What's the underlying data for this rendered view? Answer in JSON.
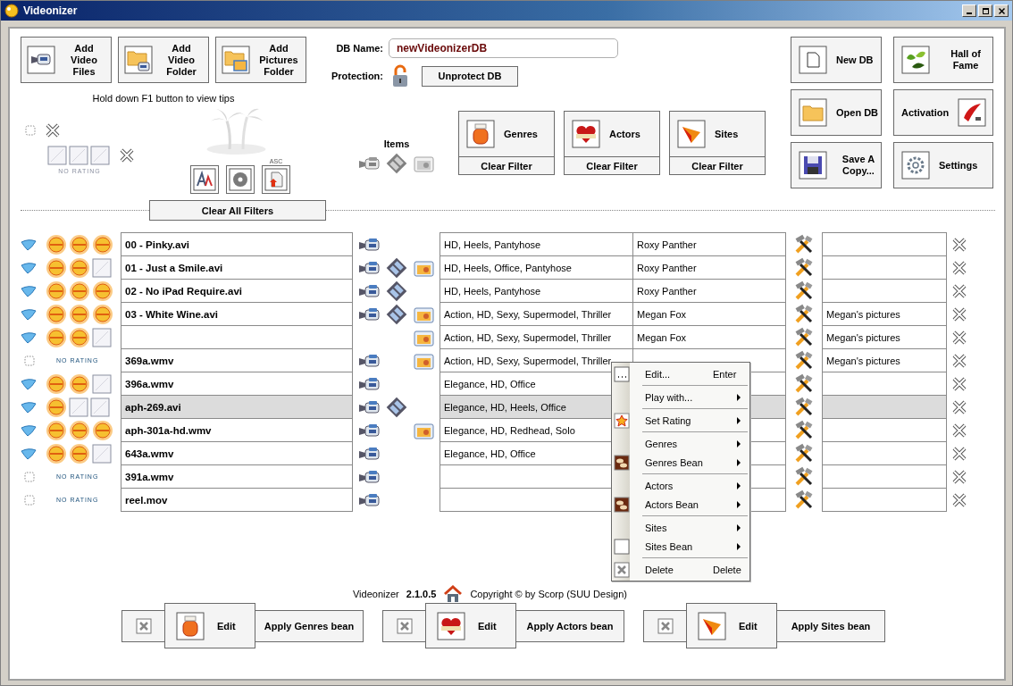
{
  "window": {
    "title": "Videonizer"
  },
  "add_buttons": [
    {
      "label": "Add Video Files"
    },
    {
      "label": "Add Video Folder"
    },
    {
      "label": "Add Pictures Folder"
    }
  ],
  "tip": "Hold down F1 button to view tips",
  "db": {
    "name_label": "DB Name:",
    "name_value": "newVideonizerDB",
    "protection_label": "Protection:",
    "protect_button": "Unprotect DB"
  },
  "db_buttons": [
    {
      "label": "New DB"
    },
    {
      "label": "Hall of Fame"
    },
    {
      "label": "Open DB"
    },
    {
      "label": "Activation"
    },
    {
      "label": "Save A Copy..."
    },
    {
      "label": "Settings"
    }
  ],
  "filter": {
    "checked": false,
    "stars": 0,
    "rating_label": "NO RATING",
    "sort_order_label": "ASC"
  },
  "items_filter": {
    "label": "Items"
  },
  "category_filters": [
    {
      "label": "Genres",
      "clear": "Clear Filter"
    },
    {
      "label": "Actors",
      "clear": "Clear Filter"
    },
    {
      "label": "Sites",
      "clear": "Clear Filter"
    }
  ],
  "clear_all": "Clear All Filters",
  "rows": [
    {
      "checked": true,
      "stars": 3,
      "name": "00 - Pinky.avi",
      "video": true,
      "film": false,
      "picture": false,
      "genres": "HD, Heels, Pantyhose",
      "actors": "Roxy Panther",
      "selected": false
    },
    {
      "checked": true,
      "stars": 2,
      "name": "01 - Just a Smile.avi",
      "video": true,
      "film": true,
      "picture": true,
      "genres": "HD, Heels, Office, Pantyhose",
      "actors": "Roxy Panther",
      "selected": false
    },
    {
      "checked": true,
      "stars": 3,
      "name": "02 - No iPad Require.avi",
      "video": true,
      "film": true,
      "picture": false,
      "genres": "HD, Heels, Pantyhose",
      "actors": "Roxy Panther",
      "selected": false
    },
    {
      "checked": true,
      "stars": 3,
      "name": "03 - White Wine.avi",
      "video": true,
      "film": true,
      "picture": true,
      "genres": "Action, HD, Sexy, Supermodel, Thriller",
      "actors": "Megan Fox",
      "sites": "Megan's pictures",
      "selected": false
    },
    {
      "checked": true,
      "stars": 2,
      "video": false,
      "film": false,
      "picture": true,
      "genres": "Action, HD, Sexy, Supermodel, Thriller",
      "actors": "Megan Fox",
      "sites": "Megan's pictures",
      "selected": false
    },
    {
      "checked": false,
      "rating_label": "NO RATING",
      "name": "369a.wmv",
      "video": true,
      "film": false,
      "picture": true,
      "genres": "Action, HD, Sexy, Supermodel, Thriller",
      "sites": "Megan's pictures",
      "selected": false
    },
    {
      "checked": true,
      "stars": 2,
      "name": "396a.wmv",
      "video": true,
      "film": false,
      "picture": false,
      "genres": "Elegance, HD, Office",
      "selected": false
    },
    {
      "checked": true,
      "stars": 1,
      "name": "aph-269.avi",
      "video": true,
      "film": true,
      "picture": false,
      "genres": "Elegance, HD, Heels, Office",
      "selected": true
    },
    {
      "checked": true,
      "stars": 3,
      "name": "aph-301a-hd.wmv",
      "video": true,
      "film": false,
      "picture": true,
      "genres": "Elegance, HD, Redhead, Solo",
      "selected": false
    },
    {
      "checked": true,
      "stars": 2,
      "name": "643a.wmv",
      "video": true,
      "film": false,
      "picture": false,
      "genres": "Elegance, HD, Office",
      "selected": false
    },
    {
      "checked": false,
      "rating_label": "NO RATING",
      "name": "391a.wmv",
      "video": true,
      "film": false,
      "picture": false,
      "selected": false
    },
    {
      "checked": false,
      "rating_label": "NO RATING",
      "name": "reel.mov",
      "video": true,
      "film": false,
      "picture": false,
      "selected": false
    }
  ],
  "context_menu": {
    "items": [
      {
        "kind": "item",
        "label": "Edit...",
        "shortcut": "Enter",
        "submenu": false
      },
      {
        "kind": "separator"
      },
      {
        "kind": "item",
        "label": "Play with...",
        "submenu": true
      },
      {
        "kind": "separator"
      },
      {
        "kind": "item",
        "label": "Set Rating",
        "submenu": true
      },
      {
        "kind": "separator"
      },
      {
        "kind": "item",
        "label": "Genres",
        "submenu": true
      },
      {
        "kind": "item",
        "label": "Genres Bean",
        "submenu": true
      },
      {
        "kind": "separator"
      },
      {
        "kind": "item",
        "label": "Actors",
        "submenu": true
      },
      {
        "kind": "item",
        "label": "Actors Bean",
        "submenu": true
      },
      {
        "kind": "separator"
      },
      {
        "kind": "item",
        "label": "Sites",
        "submenu": true
      },
      {
        "kind": "item",
        "label": "Sites Bean",
        "submenu": true
      },
      {
        "kind": "separator"
      },
      {
        "kind": "item",
        "label": "Delete",
        "shortcut": "Delete",
        "submenu": false
      }
    ]
  },
  "footer": {
    "app": "Videonizer",
    "version": "2.1.0.5",
    "copyright": "Copyright © by Scorp (SUU Design)"
  },
  "bean_bars": [
    {
      "edit": "Edit",
      "apply": "Apply Genres bean"
    },
    {
      "edit": "Edit",
      "apply": "Apply Actors bean"
    },
    {
      "edit": "Edit",
      "apply": "Apply Sites bean"
    }
  ]
}
